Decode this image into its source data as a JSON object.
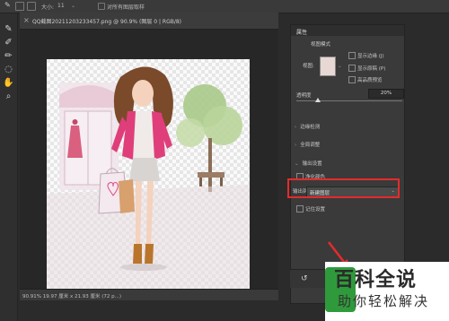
{
  "options_bar": {
    "size_label": "大小:",
    "size_value": "11",
    "sample_all_layers": "对所有图层取样"
  },
  "document": {
    "tab_title": "QQ截图20211203233457.png @ 90.9% (图层 0 | RGB/8)",
    "status": "90.91%   19.97 厘米 x 21.93 厘米 (72 p...)"
  },
  "properties": {
    "panel_title": "属性",
    "view_mode_title": "视图模式",
    "view_label": "视图:",
    "show_edge": "显示边缘 (J)",
    "show_original": "显示原稿 (P)",
    "high_quality_preview": "高品质预览",
    "opacity_label": "透明度",
    "opacity_value": "20%",
    "opacity_fraction": 0.2,
    "sections": {
      "edge_detection": "边缘检测",
      "global_refine": "全局调整",
      "output_settings": "输出设置",
      "purify_colors": "净化颜色",
      "output_to_label": "输出到:",
      "output_to_value": "新建图层",
      "remember_settings": "记住设置"
    }
  },
  "watermark": {
    "title": "百科全说",
    "subtitle": "助你轻松解决"
  }
}
